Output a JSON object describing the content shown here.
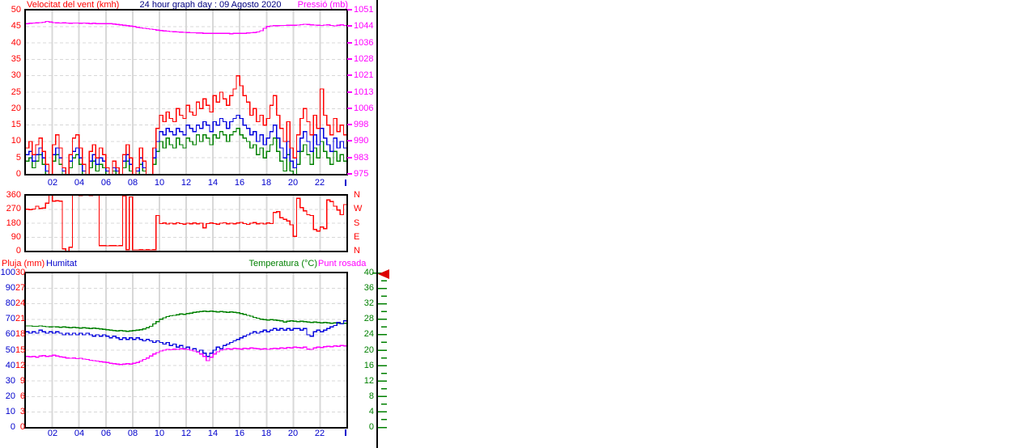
{
  "header": {
    "left_title": "Velocitat del vent (kmh)",
    "center_title": "24 hour graph day : 09 Agosto 2020",
    "right_title": "Pressió (mb)"
  },
  "bottom_header": {
    "rain_label": "Pluja (mm)",
    "humidity_label": "Humitat",
    "temperature_label": "Temperatura (°C)",
    "dewpoint_label": "Punt rosada"
  },
  "colors": {
    "red": "#ff0000",
    "blue_line": "#0000dd",
    "blue_label": "#0000cc",
    "green": "#008000",
    "magenta": "#ff00ff",
    "navy": "#000080",
    "grid": "#d8d8d8",
    "plot_border": "#000000",
    "arrow": "#dd0000"
  },
  "axes": {
    "hours": [
      "02",
      "04",
      "06",
      "08",
      "10",
      "12",
      "14",
      "16",
      "18",
      "20",
      "22"
    ],
    "wind_left": [
      "50",
      "45",
      "40",
      "35",
      "30",
      "25",
      "20",
      "15",
      "10",
      "5",
      "0"
    ],
    "pressure_right": [
      "1051",
      "1044",
      "1036",
      "1028",
      "1021",
      "1013",
      "1006",
      "998",
      "990",
      "983",
      "975"
    ],
    "direction_left": [
      "360",
      "270",
      "180",
      "90",
      "0"
    ],
    "compass_right": [
      "N",
      "W",
      "S",
      "E",
      "N"
    ],
    "humidity_left": [
      "100",
      "90",
      "80",
      "70",
      "60",
      "50",
      "40",
      "30",
      "20",
      "10",
      "0"
    ],
    "rain_left": [
      "30",
      "27",
      "24",
      "21",
      "18",
      "15",
      "12",
      "9",
      "6",
      "3",
      "0"
    ],
    "temp_right": [
      "40",
      "36",
      "32",
      "28",
      "24",
      "20",
      "16",
      "12",
      "8",
      "4",
      "0"
    ]
  },
  "chart_data": [
    {
      "type": "line",
      "title": "Velocitat del vent (kmh) / Pressió (mb)",
      "x_start_hour": 0,
      "x_end_hour": 24,
      "x_step_hours": 0.25,
      "grid": true,
      "inner_hlines": 9,
      "series": [
        {
          "name": "wind-green",
          "color": "#008000",
          "scale": [
            0,
            50
          ],
          "values": [
            4,
            5,
            2,
            4,
            6,
            3,
            0,
            0,
            4,
            6,
            3,
            0,
            0,
            2,
            5,
            6,
            3,
            0,
            0,
            2,
            4,
            1,
            3,
            2,
            0,
            0,
            1,
            0,
            0,
            2,
            4,
            1,
            0,
            0,
            3,
            1,
            0,
            0,
            3,
            7,
            10,
            8,
            11,
            9,
            8,
            11,
            9,
            8,
            11,
            10,
            9,
            12,
            10,
            12,
            11,
            9,
            12,
            11,
            13,
            12,
            10,
            12,
            13,
            14,
            12,
            11,
            10,
            8,
            9,
            6,
            8,
            5,
            7,
            9,
            11,
            7,
            4,
            1,
            6,
            1,
            0,
            3,
            7,
            9,
            6,
            3,
            8,
            5,
            10,
            7,
            5,
            3,
            7,
            4,
            6,
            4,
            5
          ]
        },
        {
          "name": "wind-blue",
          "color": "#0000dd",
          "scale": [
            0,
            50
          ],
          "values": [
            6,
            7,
            4,
            6,
            8,
            5,
            1,
            0,
            6,
            8,
            5,
            1,
            0,
            4,
            7,
            8,
            5,
            1,
            0,
            4,
            6,
            3,
            5,
            4,
            1,
            0,
            2,
            1,
            0,
            4,
            6,
            3,
            0,
            1,
            5,
            2,
            0,
            0,
            5,
            10,
            13,
            12,
            14,
            13,
            12,
            14,
            13,
            12,
            15,
            14,
            13,
            15,
            14,
            16,
            15,
            13,
            16,
            15,
            17,
            16,
            14,
            16,
            17,
            18,
            17,
            15,
            14,
            12,
            13,
            10,
            12,
            9,
            11,
            13,
            15,
            11,
            8,
            5,
            10,
            4,
            2,
            7,
            11,
            13,
            10,
            7,
            12,
            9,
            14,
            11,
            9,
            7,
            11,
            8,
            10,
            8,
            9
          ]
        },
        {
          "name": "wind-red-gust",
          "color": "#ff0000",
          "scale": [
            0,
            50
          ],
          "values": [
            8,
            10,
            6,
            9,
            11,
            7,
            3,
            0,
            9,
            12,
            8,
            2,
            0,
            6,
            11,
            12,
            8,
            3,
            0,
            7,
            9,
            5,
            8,
            6,
            2,
            0,
            4,
            2,
            0,
            6,
            9,
            5,
            0,
            2,
            8,
            4,
            0,
            0,
            8,
            14,
            18,
            16,
            19,
            17,
            16,
            20,
            18,
            17,
            21,
            19,
            18,
            22,
            20,
            23,
            21,
            19,
            24,
            22,
            25,
            23,
            21,
            24,
            26,
            30,
            27,
            24,
            22,
            18,
            20,
            16,
            18,
            15,
            17,
            21,
            24,
            18,
            14,
            10,
            16,
            8,
            5,
            12,
            17,
            20,
            16,
            12,
            18,
            14,
            26,
            18,
            15,
            12,
            17,
            13,
            15,
            12,
            13
          ]
        },
        {
          "name": "pressure",
          "color": "#ff00ff",
          "scale": [
            975,
            1051
          ],
          "values": [
            1044.8,
            1044.9,
            1045.0,
            1045.1,
            1045.2,
            1045.4,
            1045.8,
            1045.5,
            1045.2,
            1045.1,
            1045.0,
            1045.1,
            1045.0,
            1044.9,
            1045.0,
            1045.0,
            1044.9,
            1045.0,
            1044.9,
            1044.8,
            1044.9,
            1044.8,
            1044.8,
            1044.7,
            1044.8,
            1044.7,
            1044.6,
            1044.4,
            1044.2,
            1044.0,
            1043.8,
            1043.6,
            1043.4,
            1043.1,
            1042.8,
            1042.6,
            1042.4,
            1042.2,
            1042.0,
            1041.8,
            1041.6,
            1041.4,
            1041.3,
            1041.1,
            1041.0,
            1040.9,
            1040.8,
            1040.7,
            1040.6,
            1040.5,
            1040.5,
            1040.4,
            1040.4,
            1040.3,
            1040.3,
            1040.3,
            1040.2,
            1040.2,
            1040.3,
            1040.2,
            1040.2,
            1040.1,
            1040.2,
            1040.2,
            1040.2,
            1040.3,
            1040.4,
            1040.5,
            1040.6,
            1040.9,
            1041.5,
            1042.6,
            1043.4,
            1043.7,
            1043.8,
            1043.8,
            1043.9,
            1043.9,
            1044.0,
            1044.0,
            1044.0,
            1044.1,
            1044.3,
            1044.5,
            1044.4,
            1044.2,
            1044.1,
            1044.0,
            1043.9,
            1044.1,
            1044.2,
            1043.9,
            1043.7,
            1044.0,
            1044.2,
            1043.9,
            1043.8
          ]
        }
      ],
      "ylim_left_kmh": [
        0,
        50
      ],
      "ylim_right_mb": [
        975,
        1051
      ]
    },
    {
      "type": "line",
      "title": "Direcció del vent",
      "x_start_hour": 0,
      "x_end_hour": 24,
      "x_step_hours": 0.25,
      "grid": true,
      "inner_hlines": 3,
      "series": [
        {
          "name": "wind-direction",
          "color": "#ff0000",
          "scale": [
            0,
            360
          ],
          "values": [
            270,
            268,
            272,
            290,
            275,
            278,
            310,
            360,
            322,
            325,
            323,
            15,
            0,
            25,
            360,
            360,
            359,
            360,
            360,
            359,
            360,
            360,
            35,
            35,
            34,
            35,
            35,
            34,
            35,
            355,
            10,
            350,
            8,
            8,
            9,
            8,
            9,
            8,
            10,
            230,
            178,
            182,
            175,
            180,
            176,
            183,
            178,
            174,
            180,
            177,
            182,
            176,
            180,
            150,
            178,
            182,
            178,
            174,
            180,
            183,
            177,
            180,
            176,
            182,
            185,
            178,
            172,
            180,
            184,
            176,
            180,
            175,
            182,
            178,
            250,
            255,
            215,
            205,
            195,
            170,
            95,
            340,
            280,
            260,
            235,
            230,
            140,
            130,
            155,
            145,
            330,
            320,
            290,
            265,
            235,
            300,
            285
          ]
        }
      ],
      "ylim": [
        0,
        360
      ]
    },
    {
      "type": "line",
      "title": "Pluja (mm) / Humitat / Temperatura (°C) / Punt rosada",
      "x_start_hour": 0,
      "x_end_hour": 24,
      "x_step_hours": 0.25,
      "grid": true,
      "inner_hlines": 9,
      "series": [
        {
          "name": "temperature",
          "color": "#008000",
          "scale": [
            0,
            40
          ],
          "values": [
            26.3,
            26.3,
            26.2,
            26.2,
            26.3,
            26.2,
            26.1,
            26.0,
            26.1,
            26.0,
            25.9,
            26.0,
            25.9,
            25.8,
            25.9,
            25.8,
            25.7,
            25.8,
            25.7,
            25.6,
            25.7,
            25.6,
            25.5,
            25.4,
            25.3,
            25.2,
            25.1,
            25.0,
            25.1,
            25.0,
            24.9,
            25.0,
            25.1,
            25.2,
            25.3,
            25.5,
            25.8,
            26.2,
            26.8,
            27.4,
            28.0,
            28.4,
            28.7,
            28.9,
            29.0,
            29.2,
            29.4,
            29.3,
            29.5,
            29.6,
            29.8,
            29.9,
            30.0,
            30.1,
            30.0,
            30.1,
            30.0,
            29.9,
            30.0,
            29.9,
            29.8,
            29.9,
            29.8,
            29.7,
            29.5,
            29.3,
            29.0,
            28.8,
            28.5,
            28.3,
            28.0,
            27.9,
            27.8,
            27.9,
            27.8,
            27.7,
            27.6,
            27.3,
            27.5,
            27.6,
            27.5,
            27.4,
            27.5,
            27.4,
            27.3,
            27.2,
            27.3,
            27.2,
            27.1,
            27.2,
            27.1,
            27.0,
            27.1,
            27.0,
            26.9,
            27.0,
            26.9
          ]
        },
        {
          "name": "humidity",
          "color": "#0000dd",
          "scale": [
            0,
            100
          ],
          "values": [
            62,
            61,
            62,
            61,
            63,
            62,
            61,
            62,
            61,
            62,
            61,
            60,
            61,
            60,
            61,
            60,
            61,
            60,
            61,
            60,
            59,
            60,
            59,
            60,
            59,
            58,
            59,
            58,
            57,
            58,
            57,
            58,
            57,
            58,
            57,
            56,
            57,
            56,
            55,
            56,
            55,
            54,
            55,
            53,
            54,
            52,
            53,
            51,
            52,
            50,
            51,
            49,
            50,
            48,
            46,
            48,
            50,
            52,
            51,
            53,
            54,
            55,
            56,
            57,
            58,
            59,
            60,
            61,
            62,
            61,
            62,
            63,
            62,
            63,
            64,
            63,
            64,
            63,
            64,
            63,
            64,
            64,
            63,
            64,
            60,
            59,
            62,
            63,
            62,
            63,
            64,
            65,
            66,
            68,
            67,
            69,
            70
          ]
        },
        {
          "name": "dew-point",
          "color": "#ff00ff",
          "scale": [
            0,
            40
          ],
          "values": [
            18.4,
            18.3,
            18.4,
            18.2,
            18.5,
            18.6,
            18.4,
            18.5,
            18.7,
            18.5,
            18.3,
            18.2,
            18.0,
            17.9,
            18.0,
            17.8,
            17.9,
            17.7,
            17.6,
            17.4,
            17.3,
            17.2,
            17.0,
            16.9,
            16.8,
            16.6,
            16.5,
            16.4,
            16.3,
            16.4,
            16.5,
            16.4,
            16.6,
            16.8,
            17.2,
            17.6,
            18.0,
            18.5,
            19.0,
            19.4,
            19.8,
            20.0,
            20.2,
            20.1,
            20.3,
            20.2,
            20.4,
            20.3,
            20.2,
            20.0,
            19.8,
            19.5,
            19.0,
            18.4,
            17.3,
            18.2,
            19.0,
            19.6,
            20.0,
            20.2,
            20.4,
            20.3,
            20.5,
            20.4,
            20.3,
            20.5,
            20.4,
            20.6,
            20.5,
            20.4,
            20.3,
            20.4,
            20.2,
            20.4,
            20.5,
            20.4,
            20.6,
            20.5,
            20.7,
            20.6,
            20.8,
            20.7,
            20.6,
            20.8,
            20.3,
            20.2,
            20.6,
            20.8,
            20.7,
            20.9,
            21.0,
            20.9,
            21.1,
            21.0,
            21.2,
            21.1,
            21.2
          ]
        },
        {
          "name": "rain",
          "color": "#ff0000",
          "scale": [
            0,
            30
          ],
          "constant": 0
        }
      ],
      "ylim_humidity": [
        0,
        100
      ],
      "ylim_rain_mm": [
        0,
        30
      ],
      "ylim_temp_c": [
        0,
        40
      ]
    }
  ],
  "current_marker": {
    "axis": "temp_right",
    "at_value": "40"
  }
}
